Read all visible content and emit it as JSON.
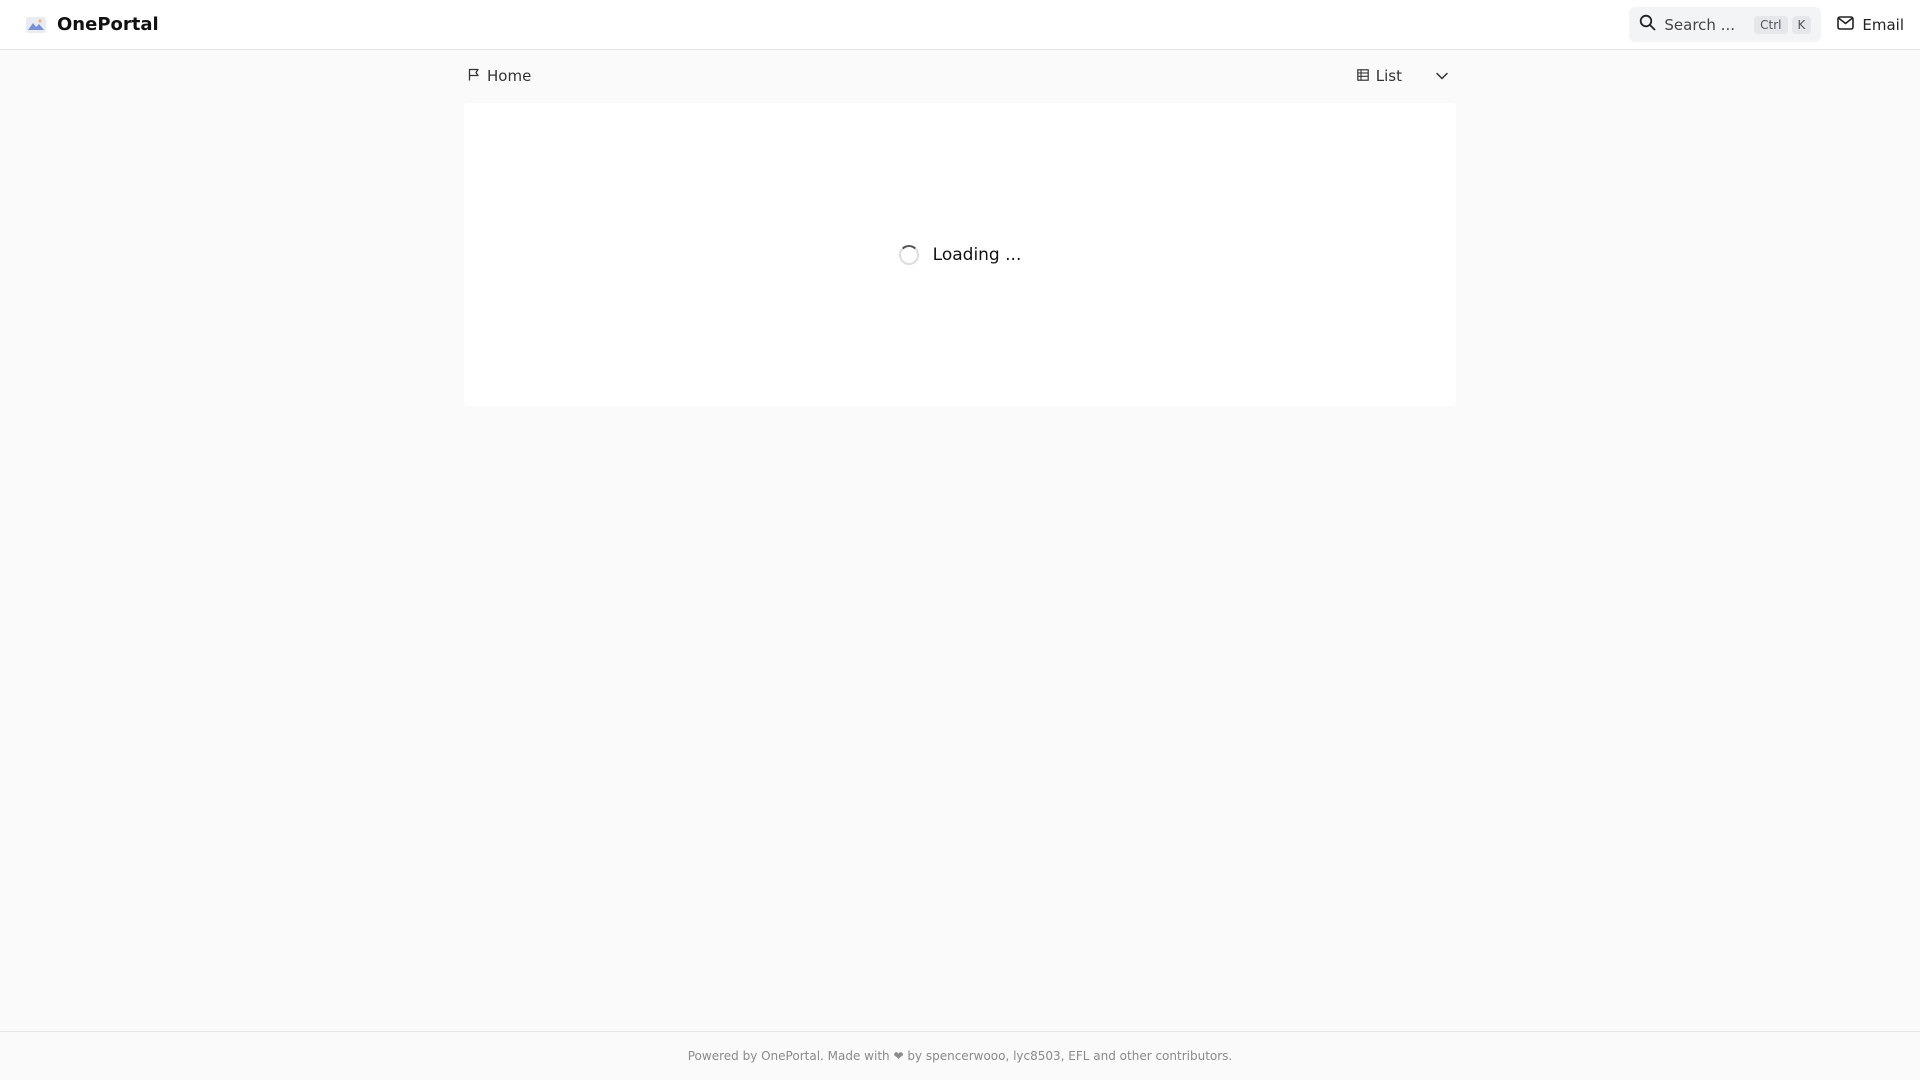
{
  "header": {
    "brand_name": "OnePortal",
    "search_placeholder": "Search ...",
    "shortcut_keys": [
      "Ctrl",
      "K"
    ],
    "email_label": "Email"
  },
  "toolbar": {
    "breadcrumb_home": "Home",
    "view_label": "List"
  },
  "main": {
    "loading_text": "Loading ..."
  },
  "footer": {
    "text": "Powered by OnePortal. Made with ❤ by spencerwooo, lyc8503, EFL and other contributors."
  },
  "icons": {
    "brand": "portal-logo-icon",
    "search": "search-icon",
    "email": "mail-icon",
    "home": "flag-icon",
    "view": "table-icon",
    "dropdown": "chevron-down-icon"
  }
}
